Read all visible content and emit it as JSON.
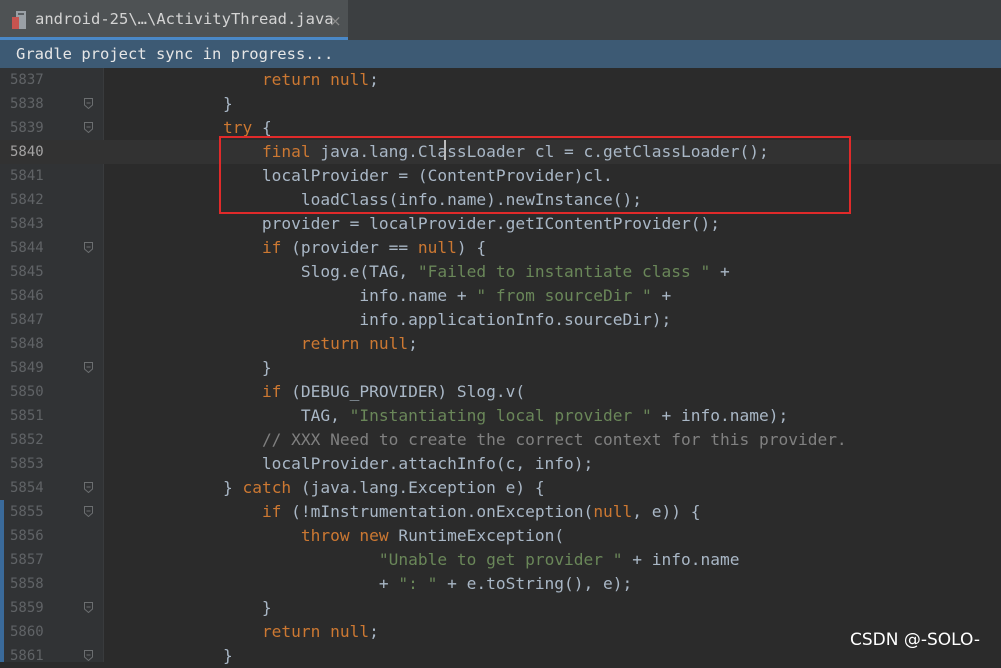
{
  "tab": {
    "label": "android-25\\…\\ActivityThread.java",
    "close": "×"
  },
  "notice": {
    "text": "Gradle project sync in progress..."
  },
  "colors": {
    "background": "#2b2b2b",
    "keyword": "#cc7832",
    "string": "#6a8759",
    "comment": "#808080",
    "plain": "#a9b7c6",
    "highlight_box": "#e02a2a"
  },
  "editor": {
    "current_line": "5840",
    "lines": [
      {
        "num": "5837",
        "fold": false,
        "tokens": [
          {
            "t": "pl",
            "v": "                "
          },
          {
            "t": "kw",
            "v": "return null"
          },
          {
            "t": "pl",
            "v": ";"
          }
        ]
      },
      {
        "num": "5838",
        "fold": true,
        "tokens": [
          {
            "t": "pl",
            "v": "            }"
          }
        ]
      },
      {
        "num": "5839",
        "fold": true,
        "tokens": [
          {
            "t": "pl",
            "v": "            "
          },
          {
            "t": "kw",
            "v": "try"
          },
          {
            "t": "pl",
            "v": " {"
          }
        ]
      },
      {
        "num": "5840",
        "fold": false,
        "tokens": [
          {
            "t": "pl",
            "v": "                "
          },
          {
            "t": "kw",
            "v": "final"
          },
          {
            "t": "pl",
            "v": " java.lang.ClassLoader cl = c.getClassLoader();"
          }
        ]
      },
      {
        "num": "5841",
        "fold": false,
        "tokens": [
          {
            "t": "pl",
            "v": "                localProvider = (ContentProvider)cl."
          }
        ]
      },
      {
        "num": "5842",
        "fold": false,
        "tokens": [
          {
            "t": "pl",
            "v": "                    loadClass(info.name).newInstance();"
          }
        ]
      },
      {
        "num": "5843",
        "fold": false,
        "tokens": [
          {
            "t": "pl",
            "v": "                provider = localProvider.getIContentProvider();"
          }
        ]
      },
      {
        "num": "5844",
        "fold": true,
        "tokens": [
          {
            "t": "pl",
            "v": "                "
          },
          {
            "t": "kw",
            "v": "if"
          },
          {
            "t": "pl",
            "v": " (provider == "
          },
          {
            "t": "kw",
            "v": "null"
          },
          {
            "t": "pl",
            "v": ") {"
          }
        ]
      },
      {
        "num": "5845",
        "fold": false,
        "tokens": [
          {
            "t": "pl",
            "v": "                    Slog.e(TAG, "
          },
          {
            "t": "str",
            "v": "\"Failed to instantiate class \""
          },
          {
            "t": "pl",
            "v": " +"
          }
        ]
      },
      {
        "num": "5846",
        "fold": false,
        "tokens": [
          {
            "t": "pl",
            "v": "                          info.name + "
          },
          {
            "t": "str",
            "v": "\" from sourceDir \""
          },
          {
            "t": "pl",
            "v": " +"
          }
        ]
      },
      {
        "num": "5847",
        "fold": false,
        "tokens": [
          {
            "t": "pl",
            "v": "                          info.applicationInfo.sourceDir);"
          }
        ]
      },
      {
        "num": "5848",
        "fold": false,
        "tokens": [
          {
            "t": "pl",
            "v": "                    "
          },
          {
            "t": "kw",
            "v": "return null"
          },
          {
            "t": "pl",
            "v": ";"
          }
        ]
      },
      {
        "num": "5849",
        "fold": true,
        "tokens": [
          {
            "t": "pl",
            "v": "                }"
          }
        ]
      },
      {
        "num": "5850",
        "fold": false,
        "tokens": [
          {
            "t": "pl",
            "v": "                "
          },
          {
            "t": "kw",
            "v": "if"
          },
          {
            "t": "pl",
            "v": " (DEBUG_PROVIDER) Slog.v("
          }
        ]
      },
      {
        "num": "5851",
        "fold": false,
        "tokens": [
          {
            "t": "pl",
            "v": "                    TAG, "
          },
          {
            "t": "str",
            "v": "\"Instantiating local provider \""
          },
          {
            "t": "pl",
            "v": " + info.name);"
          }
        ]
      },
      {
        "num": "5852",
        "fold": false,
        "tokens": [
          {
            "t": "pl",
            "v": "                "
          },
          {
            "t": "cm",
            "v": "// XXX Need to create the correct context for this provider."
          }
        ]
      },
      {
        "num": "5853",
        "fold": false,
        "tokens": [
          {
            "t": "pl",
            "v": "                localProvider.attachInfo(c, info);"
          }
        ]
      },
      {
        "num": "5854",
        "fold": true,
        "tokens": [
          {
            "t": "pl",
            "v": "            } "
          },
          {
            "t": "kw",
            "v": "catch"
          },
          {
            "t": "pl",
            "v": " (java.lang.Exception e) {"
          }
        ]
      },
      {
        "num": "5855",
        "fold": true,
        "tokens": [
          {
            "t": "pl",
            "v": "                "
          },
          {
            "t": "kw",
            "v": "if"
          },
          {
            "t": "pl",
            "v": " (!mInstrumentation.onException("
          },
          {
            "t": "kw",
            "v": "null"
          },
          {
            "t": "pl",
            "v": ", e)) {"
          }
        ]
      },
      {
        "num": "5856",
        "fold": false,
        "tokens": [
          {
            "t": "pl",
            "v": "                    "
          },
          {
            "t": "kw",
            "v": "throw new"
          },
          {
            "t": "pl",
            "v": " RuntimeException("
          }
        ]
      },
      {
        "num": "5857",
        "fold": false,
        "tokens": [
          {
            "t": "pl",
            "v": "                            "
          },
          {
            "t": "str",
            "v": "\"Unable to get provider \""
          },
          {
            "t": "pl",
            "v": " + info.name"
          }
        ]
      },
      {
        "num": "5858",
        "fold": false,
        "tokens": [
          {
            "t": "pl",
            "v": "                            + "
          },
          {
            "t": "str",
            "v": "\": \""
          },
          {
            "t": "pl",
            "v": " + e.toString(), e);"
          }
        ]
      },
      {
        "num": "5859",
        "fold": true,
        "tokens": [
          {
            "t": "pl",
            "v": "                }"
          }
        ]
      },
      {
        "num": "5860",
        "fold": false,
        "tokens": [
          {
            "t": "pl",
            "v": "                "
          },
          {
            "t": "kw",
            "v": "return null"
          },
          {
            "t": "pl",
            "v": ";"
          }
        ]
      },
      {
        "num": "5861",
        "fold": true,
        "tokens": [
          {
            "t": "pl",
            "v": "            }"
          }
        ]
      }
    ]
  },
  "watermark": "CSDN @-SOLO-"
}
